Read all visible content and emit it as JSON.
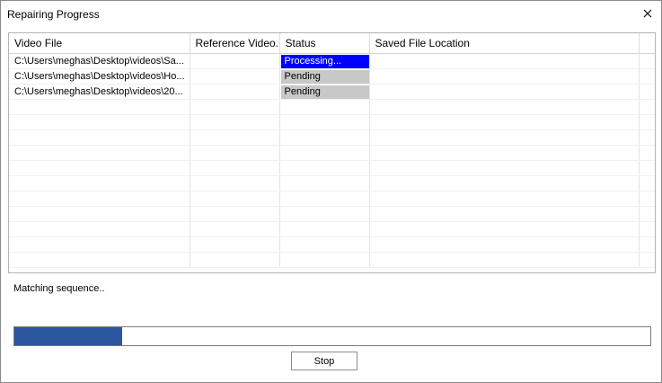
{
  "window": {
    "title": "Repairing Progress",
    "close_icon": "close-icon"
  },
  "table": {
    "columns": [
      "Video File",
      "Reference Video...",
      "Status",
      "Saved File Location",
      ""
    ],
    "rows": [
      {
        "video_file": "C:\\Users\\meghas\\Desktop\\videos\\Sa...",
        "reference_video": "",
        "status": "Processing...",
        "status_kind": "processing",
        "saved_location": ""
      },
      {
        "video_file": "C:\\Users\\meghas\\Desktop\\videos\\Ho...",
        "reference_video": "",
        "status": "Pending",
        "status_kind": "pending",
        "saved_location": ""
      },
      {
        "video_file": "C:\\Users\\meghas\\Desktop\\videos\\20...",
        "reference_video": "",
        "status": "Pending",
        "status_kind": "pending",
        "saved_location": ""
      }
    ]
  },
  "status_message": "Matching sequence..",
  "progress": {
    "fraction": 0.17,
    "color": "#2b57a0"
  },
  "buttons": {
    "stop_label": "Stop"
  },
  "colors": {
    "processing_bg": "#0000ff",
    "pending_bg": "#c8c8c8"
  }
}
